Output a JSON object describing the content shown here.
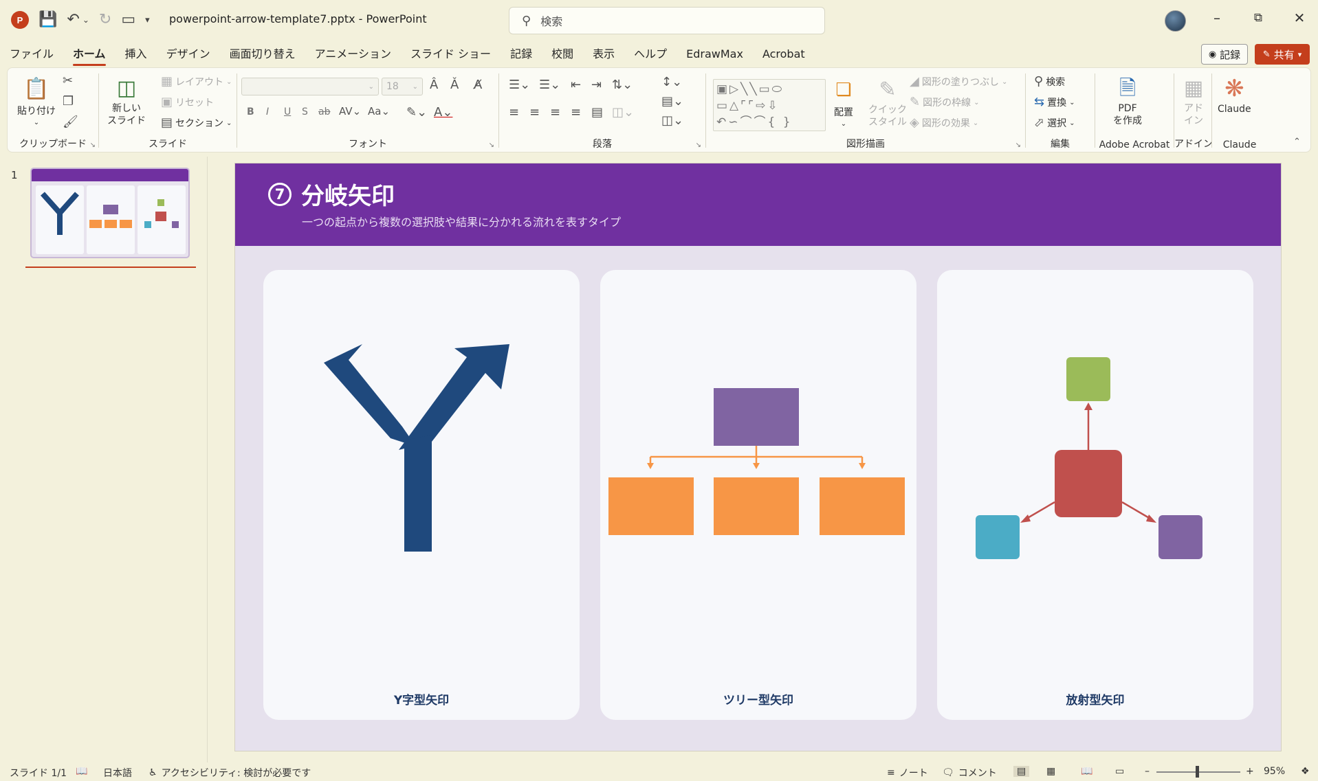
{
  "titlebar": {
    "app_logo": "P",
    "doc_title": "powerpoint-arrow-template7.pptx  -  PowerPoint",
    "search_placeholder": "検索",
    "icons": [
      "save-icon",
      "undo-icon",
      "redo-icon",
      "present-icon",
      "customize-icon"
    ]
  },
  "menu": {
    "tabs": [
      "ファイル",
      "ホーム",
      "挿入",
      "デザイン",
      "画面切り替え",
      "アニメーション",
      "スライド ショー",
      "記録",
      "校閲",
      "表示",
      "ヘルプ",
      "EdrawMax",
      "Acrobat"
    ],
    "active_tab": "ホーム",
    "record_button": "記録",
    "share_button": "共有"
  },
  "ribbon": {
    "clipboard": {
      "paste": "貼り付け",
      "label": "クリップボード"
    },
    "slides": {
      "new_slide": "新しい\nスライド",
      "layout": "レイアウト",
      "reset": "リセット",
      "section": "セクション",
      "label": "スライド"
    },
    "font": {
      "size": "18",
      "bold": "B",
      "italic": "I",
      "underline": "U",
      "shadow": "S",
      "strike": "ab",
      "label": "フォント"
    },
    "paragraph": {
      "label": "段落"
    },
    "drawing": {
      "arrange": "配置",
      "quick_style": "クイック\nスタイル",
      "fill": "図形の塗りつぶし",
      "outline": "図形の枠線",
      "effects": "図形の効果",
      "label": "図形描画"
    },
    "editing": {
      "find": "検索",
      "replace": "置換",
      "select": "選択",
      "label": "編集"
    },
    "acrobat": {
      "pdf": "PDF\nを作成",
      "label": "Adobe Acrobat"
    },
    "addin": {
      "addin": "アド\nイン",
      "label": "アドイン"
    },
    "claude": {
      "claude": "Claude",
      "label": "Claude"
    }
  },
  "slides_panel": {
    "slide_number": "1"
  },
  "slide": {
    "number_badge": "7",
    "title": "分岐矢印",
    "subtitle": "一つの起点から複数の選択肢や結果に分かれる流れを表すタイプ",
    "header_color": "#7030a0",
    "cards": [
      {
        "label": "Y字型矢印",
        "arrow_color": "#1f497d"
      },
      {
        "label": "ツリー型矢印",
        "root_color": "#8064a2",
        "child_color": "#f79646"
      },
      {
        "label": "放射型矢印",
        "center_color": "#c0504d",
        "top_color": "#9bbb59",
        "left_color": "#4bacc6",
        "right_color": "#8064a2"
      }
    ]
  },
  "statusbar": {
    "slide_info": "スライド 1/1",
    "language": "日本語",
    "accessibility": "アクセシビリティ: 検討が必要です",
    "notes": "ノート",
    "comments": "コメント",
    "zoom": "95%"
  }
}
